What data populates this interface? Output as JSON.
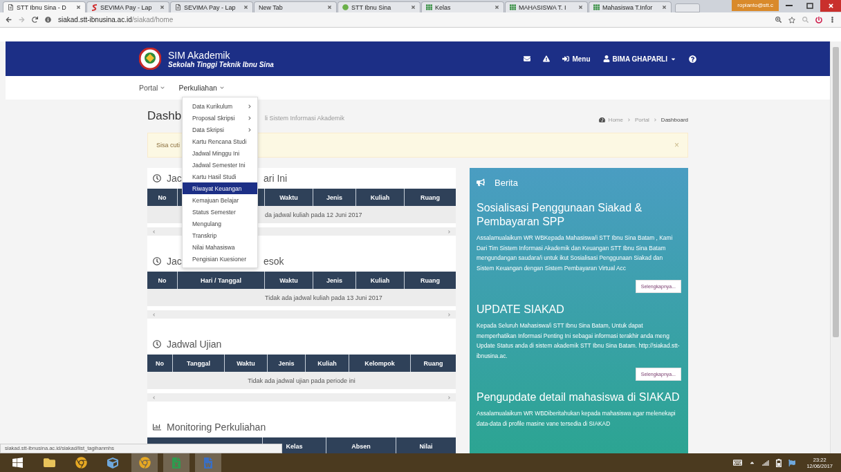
{
  "browser": {
    "tabs": [
      {
        "title": "STT Ibnu Sina - D",
        "kind": "doc",
        "selected": true
      },
      {
        "title": "SEVIMA Pay - Lap",
        "kind": "swoosh",
        "selected": false
      },
      {
        "title": "SEVIMA Pay - Lap",
        "kind": "doc",
        "selected": false
      },
      {
        "title": "New Tab",
        "kind": "blank",
        "selected": false
      },
      {
        "title": "STT Ibnu Sina",
        "kind": "circle",
        "selected": false
      },
      {
        "title": "Kelas",
        "kind": "board",
        "selected": false
      },
      {
        "title": "MAHASISWA T. I",
        "kind": "board",
        "selected": false
      },
      {
        "title": "Mahasiswa T.Infor",
        "kind": "board",
        "selected": false
      }
    ],
    "profile": "ropianto@stt.c",
    "url_host": "siakad.stt-ibnusina.ac.id",
    "url_path": "/siakad/home",
    "status_url": "siakad.stt-ibnusina.ac.id/siakad/list_tagihanmhs"
  },
  "header": {
    "app_name": "SIM Akademik",
    "institution": "Sekolah Tinggi Teknik Ibnu Sina",
    "menu": "Menu",
    "user": "BIMA GHAPARLI"
  },
  "nav": [
    {
      "label": "Portal",
      "open": false
    },
    {
      "label": "Perkuliahan",
      "open": true
    }
  ],
  "dropdown": [
    {
      "label": "Data Kurikulum",
      "submenu": true,
      "selected": false
    },
    {
      "label": "Proposal Skripsi",
      "submenu": true,
      "selected": false
    },
    {
      "label": "Data Skripsi",
      "submenu": true,
      "selected": false
    },
    {
      "label": "Kartu Rencana Studi",
      "submenu": false,
      "selected": false
    },
    {
      "label": "Jadwal Minggu Ini",
      "submenu": false,
      "selected": false
    },
    {
      "label": "Jadwal Semester Ini",
      "submenu": false,
      "selected": false
    },
    {
      "label": "Kartu Hasil Studi",
      "submenu": false,
      "selected": false
    },
    {
      "label": "Riwayat Keuangan",
      "submenu": false,
      "selected": true
    },
    {
      "label": "Kemajuan Belajar",
      "submenu": false,
      "selected": false
    },
    {
      "label": "Status Semester",
      "submenu": false,
      "selected": false
    },
    {
      "label": "Mengulang",
      "submenu": false,
      "selected": false
    },
    {
      "label": "Transkrip",
      "submenu": false,
      "selected": false
    },
    {
      "label": "Nilai Mahasiswa",
      "submenu": false,
      "selected": false
    },
    {
      "label": "Pengisian Kuesioner",
      "submenu": false,
      "selected": false
    }
  ],
  "page": {
    "title": "Dashb",
    "subtitle": "li Sistem Informasi Akademik",
    "breadcrumb": [
      "Home",
      "Portal",
      "Dashboard"
    ]
  },
  "alert": {
    "text": "Sisa cuti",
    "close": "×"
  },
  "schedules": [
    {
      "kind": "schedule",
      "title": [
        "Jac",
        "ari Ini"
      ],
      "columns": [
        {
          "label": "No"
        },
        {},
        {
          "label": "Waktu"
        },
        {
          "label": "Jenis"
        },
        {
          "label": "Kuliah"
        },
        {
          "label": "Ruang"
        }
      ],
      "message": "da jadwal kuliah pada 12 Juni 2017"
    },
    {
      "kind": "schedule",
      "title": [
        "Jac",
        "esok"
      ],
      "columns": [
        {
          "label": "No"
        },
        {
          "label": "Hari / Tanggal"
        },
        {
          "label": "Waktu"
        },
        {
          "label": "Jenis"
        },
        {
          "label": "Kuliah"
        },
        {
          "label": "Ruang"
        }
      ],
      "message": "Tidak ada jadwal kuliah pada 13 Juni 2017"
    },
    {
      "kind": "schedule",
      "title": [
        "Jadwal Ujian"
      ],
      "columns": [
        {
          "label": "No"
        },
        {
          "label": "Tanggal"
        },
        {
          "label": "Waktu"
        },
        {
          "label": "Jenis"
        },
        {
          "label": "Kuliah"
        },
        {
          "label": "Kelompok"
        },
        {
          "label": "Ruang"
        }
      ],
      "message": "Tidak ada jadwal ujian pada periode ini"
    },
    {
      "kind": "monitoring",
      "title": [
        "Monitoring Perkuliahan"
      ],
      "columns": [
        {},
        {
          "label": "Kelas"
        },
        {
          "label": "Absen"
        },
        {
          "label": "Nilai"
        }
      ]
    }
  ],
  "news": {
    "title": "Berita",
    "items": [
      {
        "headline": "Sosialisasi Penggunaan Siakad & Pembayaran SPP",
        "body": "Assalamualaikum WR WBKepada Mahasiswa/i STT Ibnu Sina Batam , Kami Dari Tim Sistem Informasi Akademik dan Keuangan STT Ibnu Sina Batam mengundangan saudara/i untuk ikut Sosialisasi Penggunaan Siakad dan Sistem Keuangan dengan Sistem Pembayaran Virtual Acc",
        "button": "Selengkapnya..."
      },
      {
        "headline": "UPDATE SIAKAD",
        "body": "Kepada Seluruh Mahasiswa/i STT Ibnu Sina Batam, Untuk dapat memperhatikan Informasi Penting Ini sebagai informasi terakhir anda meng Update Status anda di sistem akademik STT Ibnu Sina Batam. http://siakad.stt-ibnusina.ac.",
        "button": "Selengkapnya..."
      },
      {
        "headline": "Pengupdate detail mahasiswa di SIAKAD",
        "body": "Assalamualaikum WR WBDiberitahukan kepada mahasiswa agar melenekapi data-data di profile masine vane tersedia di SIAKAD"
      }
    ]
  },
  "taskbar": {
    "apps": [
      {
        "kind": "start",
        "running": false
      },
      {
        "kind": "folder",
        "running": false
      },
      {
        "kind": "chrome",
        "running": false
      },
      {
        "kind": "app",
        "running": false
      },
      {
        "kind": "chrome",
        "running": true
      },
      {
        "kind": "excel",
        "running": true
      },
      {
        "kind": "word",
        "running": true
      }
    ],
    "time": "23:22",
    "date": "12/06/2017"
  }
}
